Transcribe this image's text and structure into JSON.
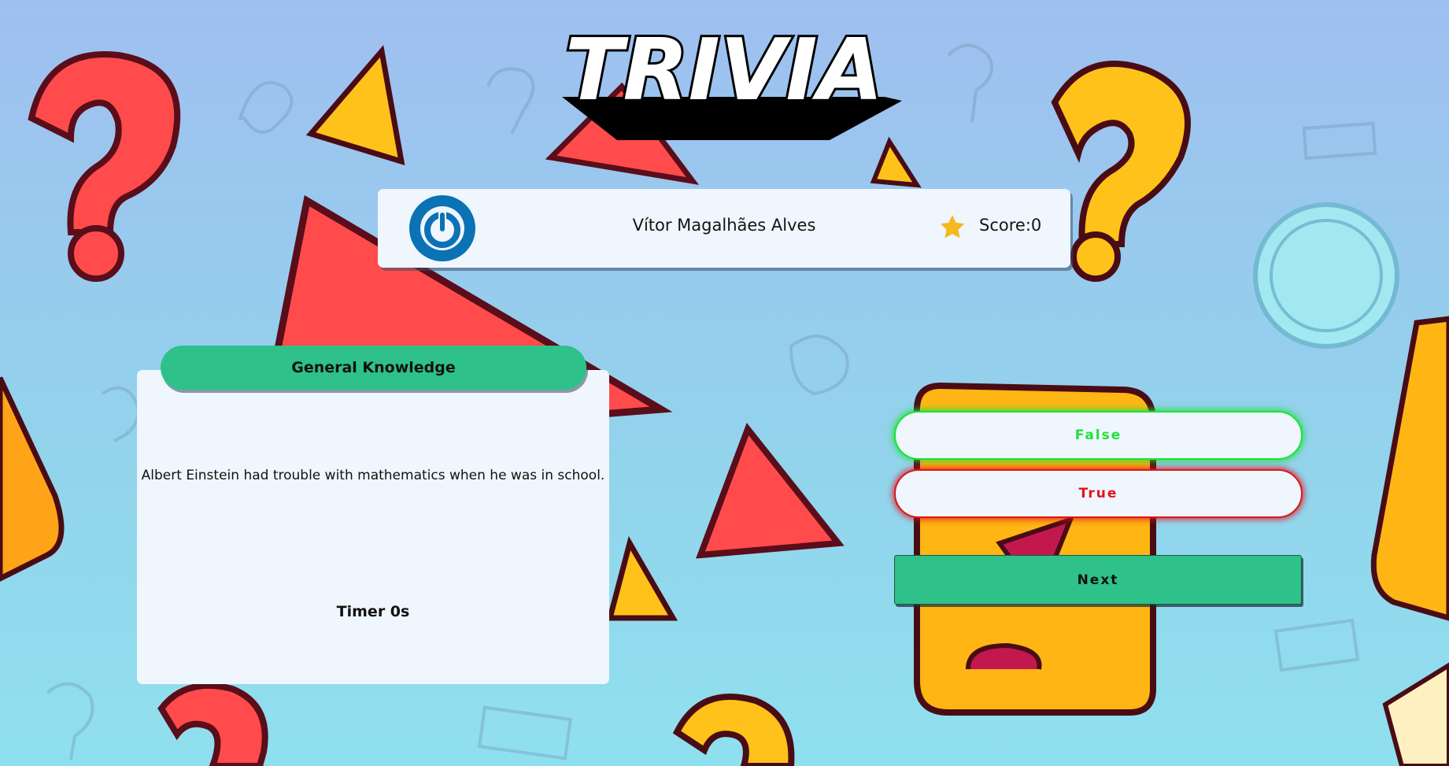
{
  "app": {
    "logo_text": "TRIVIA"
  },
  "user": {
    "name": "Vítor Magalhães Alves",
    "score_text": "Score:0",
    "power_icon": "power-icon",
    "star_icon": "star-icon"
  },
  "question": {
    "category": "General Knowledge",
    "text": "Albert Einstein had trouble with mathematics when he was in school.",
    "timer_text": "Timer 0s"
  },
  "answers": [
    {
      "label": "False",
      "color": "#1ee23c"
    },
    {
      "label": "True",
      "color": "#e0141a"
    }
  ],
  "actions": {
    "next_label": "Next"
  },
  "theme": {
    "accent_green": "#2ec18a",
    "card_bg": "#eff6fd",
    "power_blue": "#0a72b5",
    "star_yellow": "#f5b91c"
  }
}
